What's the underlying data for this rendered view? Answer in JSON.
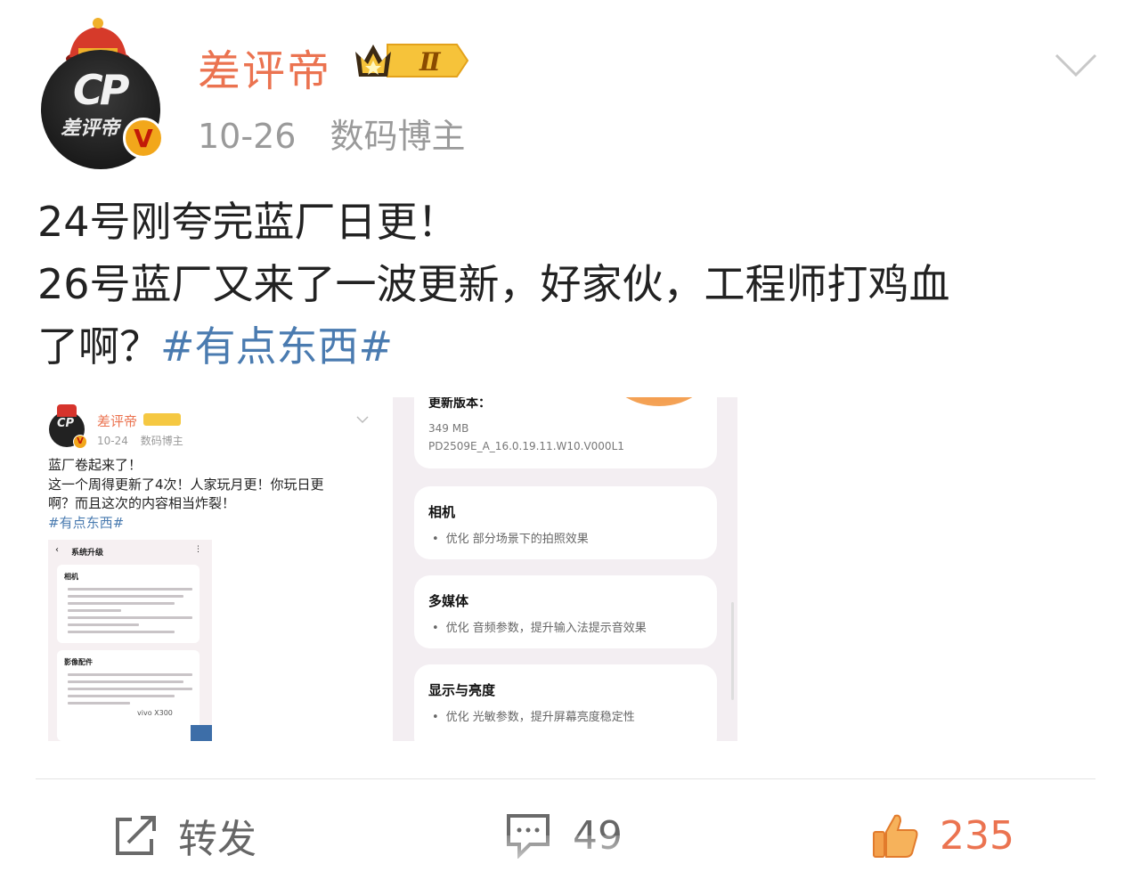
{
  "post": {
    "author": {
      "name": "差评帝",
      "level": "Ⅱ",
      "avatar_mark": "CP",
      "avatar_name": "差评帝",
      "verified_badge": "V"
    },
    "date": "10-26",
    "category": "数码博主",
    "text_lines": [
      "24号刚夸完蓝厂日更！",
      "26号蓝厂又来了一波更新，好家伙，工程师打鸡血"
    ],
    "text_tail": "了啊？",
    "hashtag": "#有点东西#",
    "actions": {
      "repost_label": "转发",
      "comment_count": "49",
      "like_count": "235"
    }
  },
  "quoted_screenshot": {
    "author_name": "差评帝",
    "date": "10-24",
    "category": "数码博主",
    "lines": [
      "蓝厂卷起来了！",
      "这一个周得更新了4次！人家玩月更！你玩日更",
      "啊？而且这次的内容相当炸裂！"
    ],
    "hashtag": "#有点东西#",
    "inner_header": "系统升级",
    "inner_sections": [
      "相机",
      "影像配件"
    ],
    "vivo_label": "vivo X300"
  },
  "update_screenshot": {
    "top_label": "更新版本：",
    "size": "349 MB",
    "version": "PD2509E_A_16.0.19.11.W10.V000L1",
    "sections": [
      {
        "title": "相机",
        "item": "优化 部分场景下的拍照效果"
      },
      {
        "title": "多媒体",
        "item": "优化 音频参数，提升输入法提示音效果"
      },
      {
        "title": "显示与亮度",
        "item": "优化 光敏参数，提升屏幕亮度稳定性"
      }
    ]
  },
  "colors": {
    "username": "#eb7350",
    "hashtag": "#4a7bb0",
    "meta": "#9a9a9a",
    "like": "#eb7350"
  }
}
